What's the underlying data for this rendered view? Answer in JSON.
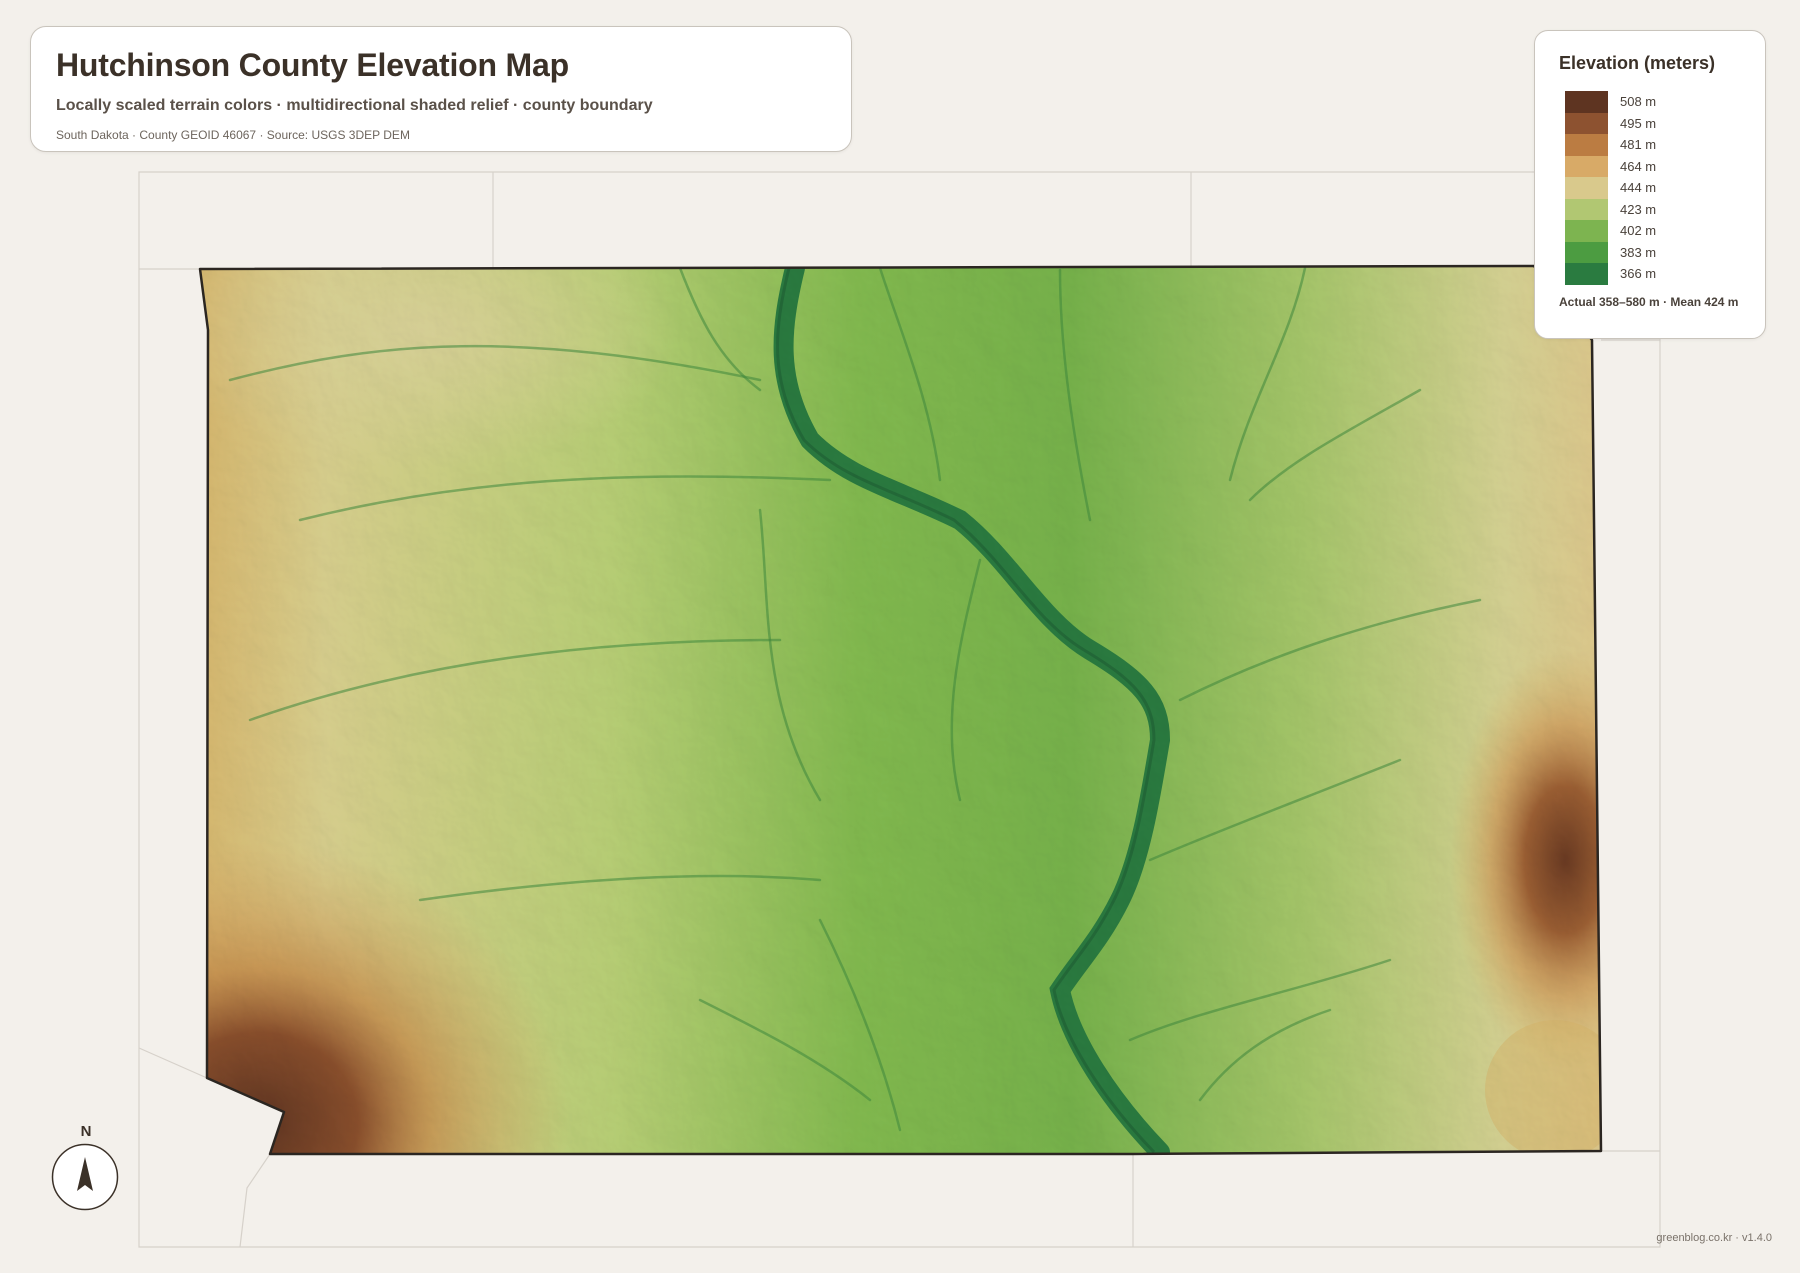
{
  "header": {
    "title": "Hutchinson County Elevation Map",
    "subtitle": "Locally scaled terrain colors · multidirectional shaded relief · county boundary",
    "source": "South Dakota · County GEOID 46067 · Source: USGS 3DEP DEM"
  },
  "legend": {
    "title": "Elevation (meters)",
    "items": [
      {
        "label": "508 m",
        "color": "#5e3421"
      },
      {
        "label": "495 m",
        "color": "#8d5230"
      },
      {
        "label": "481 m",
        "color": "#bb7c42"
      },
      {
        "label": "464 m",
        "color": "#d8aa67"
      },
      {
        "label": "444 m",
        "color": "#d9c98c"
      },
      {
        "label": "423 m",
        "color": "#b1c772"
      },
      {
        "label": "402 m",
        "color": "#7db450"
      },
      {
        "label": "383 m",
        "color": "#4c9c41"
      },
      {
        "label": "366 m",
        "color": "#2a7b40"
      }
    ],
    "summary": "Actual 358–580 m · Mean 424 m"
  },
  "north_arrow": {
    "label": "N"
  },
  "credit": "greenblog.co.kr · v1.4.0",
  "colors": {
    "background": "#f3f0eb",
    "boundary": "#2b2621",
    "river": "#2a7b40",
    "low": "#2a7b40",
    "high": "#5e3421"
  }
}
